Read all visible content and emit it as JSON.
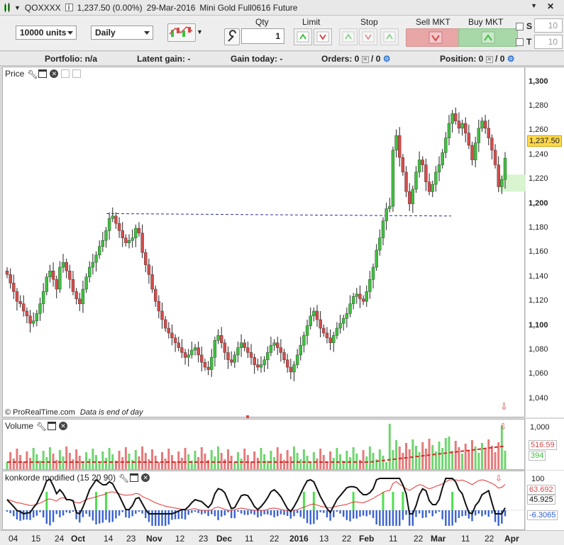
{
  "title_bar": {
    "symbol": "QOXXXX",
    "price_change": "1,237.50 (0.00%)",
    "date": "29-Mar-2016",
    "instrument": "Mini Gold Full0616 Future"
  },
  "toolbar": {
    "units_select": "10000 units",
    "period_select": "Daily",
    "qty_label": "Qty",
    "qty_value": "1",
    "limit_label": "Limit",
    "stop_label": "Stop",
    "sell_mkt_label": "Sell MKT",
    "buy_mkt_label": "Buy MKT",
    "s_label": "S",
    "t_label": "T",
    "s_value": "10",
    "t_value": "10"
  },
  "status": {
    "portfolio": "Portfolio: n/a",
    "latent_gain": "Latent gain: -",
    "gain_today": "Gain today: -",
    "orders_label": "Orders: 0",
    "orders_value": "/ 0",
    "position_label": "Position: 0",
    "position_value": "/ 0"
  },
  "price_panel": {
    "title": "Price",
    "last_price": "1,237.50",
    "y_ticks": [
      "1,300",
      "1,280",
      "1,260",
      "1,240",
      "1,220",
      "1,200",
      "1,180",
      "1,160",
      "1,140",
      "1,120",
      "1,100",
      "1,080",
      "1,060",
      "1,040"
    ],
    "footer_credit": "© ProRealTime.com",
    "footer_note": "Data is end of day",
    "colors": {
      "up": "#3fbf3f",
      "down": "#d44b4b",
      "line": "#2b2b9e"
    }
  },
  "volume_panel": {
    "title": "Volume",
    "y_tick": "1,000",
    "value_red": "516.59",
    "value_green": "394"
  },
  "konkorde_panel": {
    "title": "konkorde modified (15 20 90)",
    "y_tick": "100",
    "value_1": "63.692",
    "value_2": "45.925",
    "value_3": "-6.3065"
  },
  "x_axis": [
    "04",
    "15",
    "24",
    "Oct",
    "14",
    "23",
    "Nov",
    "12",
    "23",
    "Dec",
    "11",
    "22",
    "2016",
    "13",
    "22",
    "Feb",
    "11",
    "22",
    "Mar",
    "11",
    "22",
    "Apr"
  ],
  "chart_data": {
    "type": "candlestick",
    "series_name": "Mini Gold Full0616 Future",
    "ylim": [
      1030,
      1305
    ],
    "close": [
      1142,
      1135,
      1128,
      1120,
      1118,
      1112,
      1108,
      1102,
      1104,
      1110,
      1118,
      1128,
      1140,
      1145,
      1138,
      1130,
      1148,
      1152,
      1145,
      1138,
      1128,
      1122,
      1118,
      1130,
      1140,
      1148,
      1152,
      1158,
      1165,
      1170,
      1178,
      1188,
      1190,
      1184,
      1178,
      1172,
      1168,
      1170,
      1172,
      1180,
      1176,
      1160,
      1150,
      1142,
      1130,
      1120,
      1112,
      1105,
      1098,
      1094,
      1090,
      1086,
      1082,
      1078,
      1074,
      1076,
      1080,
      1082,
      1076,
      1070,
      1066,
      1064,
      1074,
      1088,
      1092,
      1086,
      1078,
      1072,
      1070,
      1076,
      1082,
      1086,
      1082,
      1078,
      1074,
      1068,
      1066,
      1068,
      1072,
      1078,
      1084,
      1086,
      1082,
      1078,
      1072,
      1066,
      1062,
      1068,
      1076,
      1084,
      1092,
      1100,
      1108,
      1112,
      1105,
      1098,
      1094,
      1090,
      1086,
      1092,
      1098,
      1102,
      1106,
      1110,
      1118,
      1124,
      1126,
      1122,
      1120,
      1128,
      1138,
      1148,
      1162,
      1172,
      1186,
      1196,
      1198,
      1244,
      1256,
      1238,
      1226,
      1210,
      1200,
      1212,
      1226,
      1236,
      1232,
      1218,
      1210,
      1216,
      1226,
      1232,
      1242,
      1254,
      1266,
      1274,
      1268,
      1262,
      1266,
      1258,
      1248,
      1236,
      1250,
      1262,
      1268,
      1262,
      1254,
      1244,
      1232,
      1214,
      1220,
      1237.5
    ]
  }
}
